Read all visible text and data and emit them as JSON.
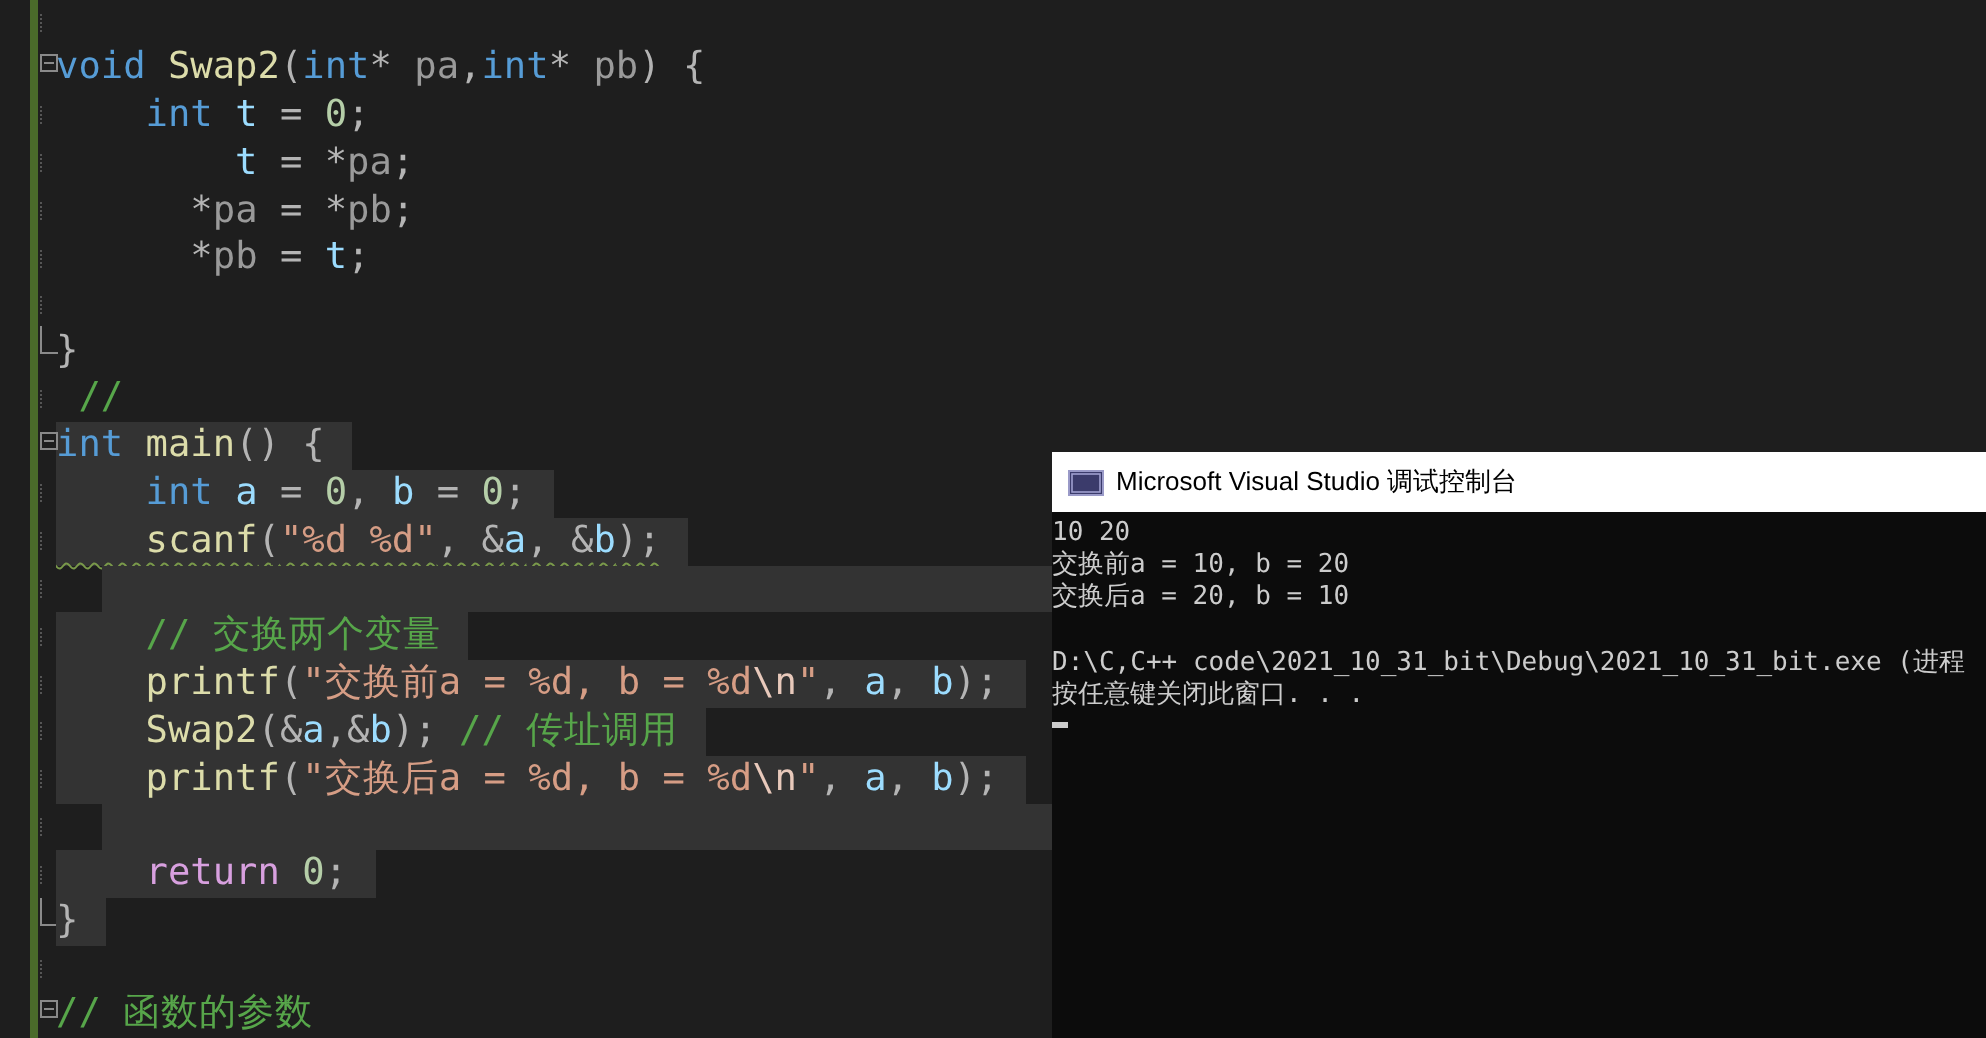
{
  "editor": {
    "lines": [
      {
        "highlighted": false
      },
      {
        "fold_start": true,
        "highlighted": false,
        "tokens": [
          {
            "kind": "keyword",
            "text": "void"
          },
          {
            "kind": "function",
            "text": " Swap2"
          },
          {
            "kind": "punct",
            "text": "("
          },
          {
            "kind": "keyword",
            "text": "int"
          },
          {
            "kind": "punct",
            "text": "* "
          },
          {
            "kind": "param",
            "text": "pa"
          },
          {
            "kind": "punct",
            "text": ","
          },
          {
            "kind": "keyword",
            "text": "int"
          },
          {
            "kind": "punct",
            "text": "* "
          },
          {
            "kind": "param",
            "text": "pb"
          },
          {
            "kind": "punct",
            "text": ") {"
          }
        ]
      },
      {
        "highlighted": false,
        "tokens": [
          {
            "kind": "keyword",
            "text": "    int"
          },
          {
            "kind": "variable",
            "text": " t"
          },
          {
            "kind": "punct",
            "text": " = "
          },
          {
            "kind": "number",
            "text": "0"
          },
          {
            "kind": "punct",
            "text": ";"
          }
        ]
      },
      {
        "highlighted": false,
        "tokens": [
          {
            "kind": "variable",
            "text": "        t"
          },
          {
            "kind": "punct",
            "text": " = *"
          },
          {
            "kind": "param",
            "text": "pa"
          },
          {
            "kind": "punct",
            "text": ";"
          }
        ]
      },
      {
        "highlighted": false,
        "tokens": [
          {
            "kind": "punct",
            "text": "      *"
          },
          {
            "kind": "param",
            "text": "pa"
          },
          {
            "kind": "punct",
            "text": " = *"
          },
          {
            "kind": "param",
            "text": "pb"
          },
          {
            "kind": "punct",
            "text": ";"
          }
        ]
      },
      {
        "highlighted": false,
        "tokens": [
          {
            "kind": "punct",
            "text": "      *"
          },
          {
            "kind": "param",
            "text": "pb"
          },
          {
            "kind": "punct",
            "text": " = "
          },
          {
            "kind": "variable",
            "text": "t"
          },
          {
            "kind": "punct",
            "text": ";"
          }
        ]
      },
      {
        "highlighted": false
      },
      {
        "fold_end": true,
        "highlighted": false,
        "tokens": [
          {
            "kind": "punct",
            "text": "}"
          }
        ]
      },
      {
        "highlighted": false,
        "tokens": [
          {
            "kind": "comment",
            "text": " //"
          }
        ]
      },
      {
        "fold_start": true,
        "highlighted": true,
        "tokens": [
          {
            "kind": "keyword",
            "text": "int"
          },
          {
            "kind": "function",
            "text": " main"
          },
          {
            "kind": "punct",
            "text": "() {"
          }
        ]
      },
      {
        "highlighted": true,
        "tokens": [
          {
            "kind": "keyword",
            "text": "    int"
          },
          {
            "kind": "variable",
            "text": " a"
          },
          {
            "kind": "punct",
            "text": " = "
          },
          {
            "kind": "number",
            "text": "0"
          },
          {
            "kind": "punct",
            "text": ", "
          },
          {
            "kind": "variable",
            "text": "b"
          },
          {
            "kind": "punct",
            "text": " = "
          },
          {
            "kind": "number",
            "text": "0"
          },
          {
            "kind": "punct",
            "text": ";"
          }
        ]
      },
      {
        "highlighted": true,
        "squiggle": true,
        "tokens": [
          {
            "kind": "function",
            "text": "    scanf"
          },
          {
            "kind": "punct",
            "text": "("
          },
          {
            "kind": "string",
            "text": "\"%d %d\""
          },
          {
            "kind": "punct",
            "text": ", &"
          },
          {
            "kind": "variable",
            "text": "a"
          },
          {
            "kind": "punct",
            "text": ", &"
          },
          {
            "kind": "variable",
            "text": "b"
          },
          {
            "kind": "punct",
            "text": ");"
          }
        ]
      },
      {
        "highlighted": true
      },
      {
        "highlighted": true,
        "tokens": [
          {
            "kind": "comment",
            "text": "    // 交换两个变量"
          }
        ]
      },
      {
        "highlighted": true,
        "tokens": [
          {
            "kind": "function",
            "text": "    printf"
          },
          {
            "kind": "punct",
            "text": "("
          },
          {
            "kind": "string",
            "text": "\"交换前a = %d, b = %d"
          },
          {
            "kind": "escape",
            "text": "\\n"
          },
          {
            "kind": "string",
            "text": "\""
          },
          {
            "kind": "punct",
            "text": ", "
          },
          {
            "kind": "variable",
            "text": "a"
          },
          {
            "kind": "punct",
            "text": ", "
          },
          {
            "kind": "variable",
            "text": "b"
          },
          {
            "kind": "punct",
            "text": ");"
          }
        ]
      },
      {
        "highlighted": true,
        "tokens": [
          {
            "kind": "function",
            "text": "    Swap2"
          },
          {
            "kind": "punct",
            "text": "(&"
          },
          {
            "kind": "variable",
            "text": "a"
          },
          {
            "kind": "punct",
            "text": ",&"
          },
          {
            "kind": "variable",
            "text": "b"
          },
          {
            "kind": "punct",
            "text": "); "
          },
          {
            "kind": "comment",
            "text": "// 传址调用"
          }
        ]
      },
      {
        "highlighted": true,
        "tokens": [
          {
            "kind": "function",
            "text": "    printf"
          },
          {
            "kind": "punct",
            "text": "("
          },
          {
            "kind": "string",
            "text": "\"交换后a = %d, b = %d"
          },
          {
            "kind": "escape",
            "text": "\\n"
          },
          {
            "kind": "string",
            "text": "\""
          },
          {
            "kind": "punct",
            "text": ", "
          },
          {
            "kind": "variable",
            "text": "a"
          },
          {
            "kind": "punct",
            "text": ", "
          },
          {
            "kind": "variable",
            "text": "b"
          },
          {
            "kind": "punct",
            "text": ");"
          }
        ]
      },
      {
        "highlighted": true
      },
      {
        "highlighted": true,
        "tokens": [
          {
            "kind": "return",
            "text": "    return"
          },
          {
            "kind": "number",
            "text": " 0"
          },
          {
            "kind": "punct",
            "text": ";"
          }
        ]
      },
      {
        "fold_end": true,
        "highlighted": true,
        "tokens": [
          {
            "kind": "punct",
            "text": "}"
          }
        ]
      },
      {
        "highlighted": false
      },
      {
        "fold_start": true,
        "highlighted": false,
        "tokens": [
          {
            "kind": "comment",
            "text": "// 函数的参数"
          }
        ]
      }
    ]
  },
  "console": {
    "title": "Microsoft Visual Studio 调试控制台",
    "output": [
      "10 20",
      "交换前a = 10, b = 20",
      "交换后a = 20, b = 10"
    ],
    "exit_message": [
      "D:\\C,C++ code\\2021_10_31_bit\\Debug\\2021_10_31_bit.exe (进程",
      "按任意键关闭此窗口. . ."
    ]
  }
}
